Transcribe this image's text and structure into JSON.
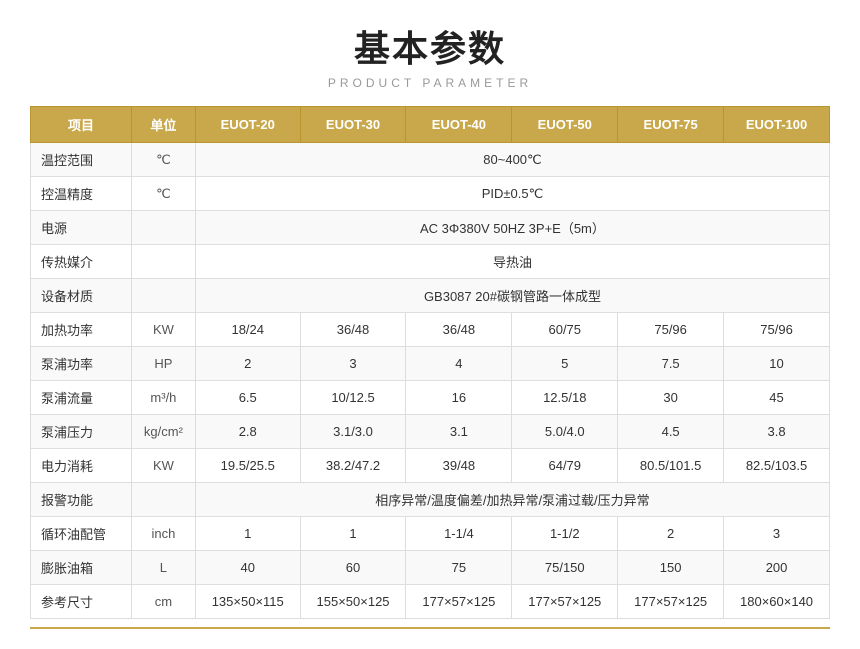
{
  "title": "基本参数",
  "subtitle": "PRODUCT PARAMETER",
  "headers": {
    "item": "项目",
    "unit": "单位",
    "euot20": "EUOT-20",
    "euot30": "EUOT-30",
    "euot40": "EUOT-40",
    "euot50": "EUOT-50",
    "euot75": "EUOT-75",
    "euot100": "EUOT-100"
  },
  "rows": [
    {
      "label": "温控范围",
      "unit": "℃",
      "values": [
        "80~400℃",
        "",
        "",
        "",
        "",
        ""
      ],
      "span": true,
      "spanText": "80~400℃"
    },
    {
      "label": "控温精度",
      "unit": "℃",
      "values": [
        "PID±0.5℃",
        "",
        "",
        "",
        "",
        ""
      ],
      "span": true,
      "spanText": "PID±0.5℃"
    },
    {
      "label": "电源",
      "unit": "",
      "values": [
        "AC 3Φ380V 50HZ 3P+E（5m）",
        "",
        "",
        "",
        "",
        ""
      ],
      "span": true,
      "spanText": "AC 3Φ380V 50HZ 3P+E（5m）"
    },
    {
      "label": "传热媒介",
      "unit": "",
      "values": [
        "导热油",
        "",
        "",
        "",
        "",
        ""
      ],
      "span": true,
      "spanText": "导热油"
    },
    {
      "label": "设备材质",
      "unit": "",
      "values": [
        "GB3087   20#碳钢管路一体成型",
        "",
        "",
        "",
        "",
        ""
      ],
      "span": true,
      "spanText": "GB3087   20#碳钢管路一体成型"
    },
    {
      "label": "加热功率",
      "unit": "KW",
      "values": [
        "18/24",
        "36/48",
        "36/48",
        "60/75",
        "75/96",
        "75/96"
      ],
      "span": false
    },
    {
      "label": "泵浦功率",
      "unit": "HP",
      "values": [
        "2",
        "3",
        "4",
        "5",
        "7.5",
        "10"
      ],
      "span": false
    },
    {
      "label": "泵浦流量",
      "unit": "m³/h",
      "values": [
        "6.5",
        "10/12.5",
        "16",
        "12.5/18",
        "30",
        "45"
      ],
      "span": false
    },
    {
      "label": "泵浦压力",
      "unit": "kg/cm²",
      "values": [
        "2.8",
        "3.1/3.0",
        "3.1",
        "5.0/4.0",
        "4.5",
        "3.8"
      ],
      "span": false
    },
    {
      "label": "电力消耗",
      "unit": "KW",
      "values": [
        "19.5/25.5",
        "38.2/47.2",
        "39/48",
        "64/79",
        "80.5/101.5",
        "82.5/103.5"
      ],
      "span": false
    },
    {
      "label": "报警功能",
      "unit": "",
      "values": [
        "相序异常/温度偏差/加热异常/泵浦过载/压力异常",
        "",
        "",
        "",
        "",
        ""
      ],
      "span": true,
      "spanText": "相序异常/温度偏差/加热异常/泵浦过载/压力异常"
    },
    {
      "label": "循环油配管",
      "unit": "inch",
      "values": [
        "1",
        "1",
        "1-1/4",
        "1-1/2",
        "2",
        "3"
      ],
      "span": false
    },
    {
      "label": "膨胀油箱",
      "unit": "L",
      "values": [
        "40",
        "60",
        "75",
        "75/150",
        "150",
        "200"
      ],
      "span": false
    },
    {
      "label": "参考尺寸",
      "unit": "cm",
      "values": [
        "135×50×115",
        "155×50×125",
        "177×57×125",
        "177×57×125",
        "177×57×125",
        "180×60×140"
      ],
      "span": false
    }
  ]
}
